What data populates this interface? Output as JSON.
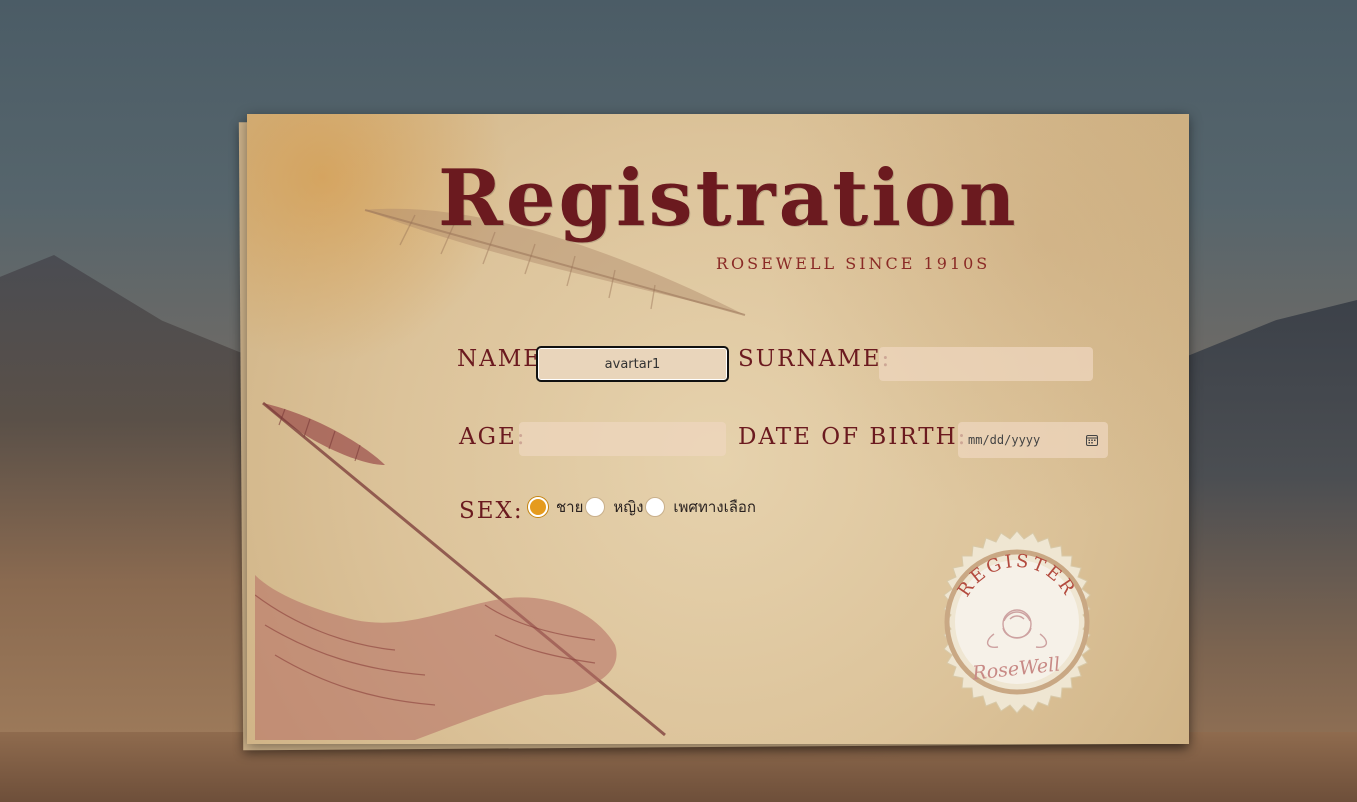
{
  "form": {
    "title": "Registration",
    "subtitle": "ROSEWELL SINCE 1910S",
    "name_label": "NAME:",
    "name_value": "avartar1",
    "surname_label": "SURNAME:",
    "surname_value": "",
    "age_label": "AGE:",
    "age_value": "",
    "dob_label": "DATE OF BIRTH:",
    "dob_placeholder": "mm/dd/yyyy",
    "sex_label": "SEX:",
    "sex_options": [
      "ชาย",
      "หญิง",
      "เพศทางเลือก"
    ],
    "sex_selected": "ชาย"
  },
  "stamp": {
    "top_text": "REGISTER",
    "bottom_text": "RoseWell"
  },
  "icons": {
    "date": "calendar-icon",
    "feather": "quill-feather-icon",
    "hand": "hand-with-quill-icon",
    "stamp": "rose-seal-icon"
  },
  "colors": {
    "title": "#6b1a1f",
    "subtitle": "#8a2a26",
    "paper": "#dcc39a",
    "radio_checked": "#e59b1e"
  }
}
